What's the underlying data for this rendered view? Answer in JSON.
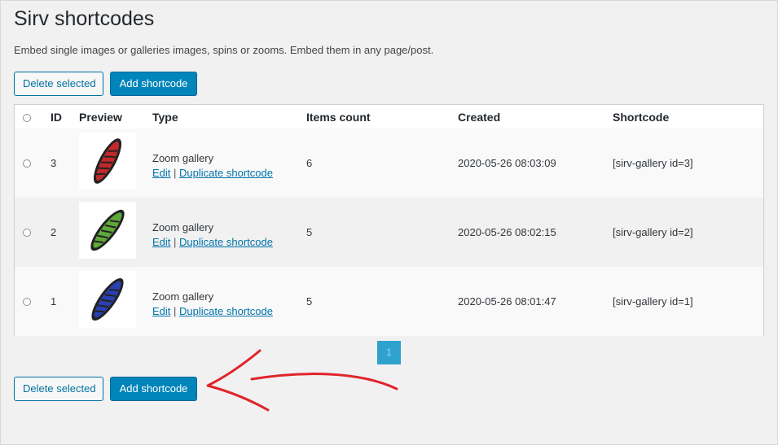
{
  "page": {
    "title": "Sirv shortcodes",
    "description": "Embed single images or galleries images, spins or zooms. Embed them in any page/post."
  },
  "actions": {
    "delete_label": "Delete selected",
    "add_label": "Add shortcode"
  },
  "table": {
    "columns": {
      "id": "ID",
      "preview": "Preview",
      "type": "Type",
      "items_count": "Items count",
      "created": "Created",
      "shortcode": "Shortcode"
    },
    "edit_label": "Edit",
    "separator": "|",
    "duplicate_label": "Duplicate shortcode",
    "rows": [
      {
        "id": "3",
        "type": "Zoom gallery",
        "items_count": "6",
        "created": "2020-05-26 08:03:09",
        "shortcode": "[sirv-gallery id=3]",
        "preview_color": "#c0292b"
      },
      {
        "id": "2",
        "type": "Zoom gallery",
        "items_count": "5",
        "created": "2020-05-26 08:02:15",
        "shortcode": "[sirv-gallery id=2]",
        "preview_color": "#5fa83a"
      },
      {
        "id": "1",
        "type": "Zoom gallery",
        "items_count": "5",
        "created": "2020-05-26 08:01:47",
        "shortcode": "[sirv-gallery id=1]",
        "preview_color": "#2a3fb0"
      }
    ]
  },
  "pagination": {
    "current": "1"
  },
  "colors": {
    "primary": "#0085ba",
    "link": "#0073aa",
    "arrow": "#e0242b"
  }
}
